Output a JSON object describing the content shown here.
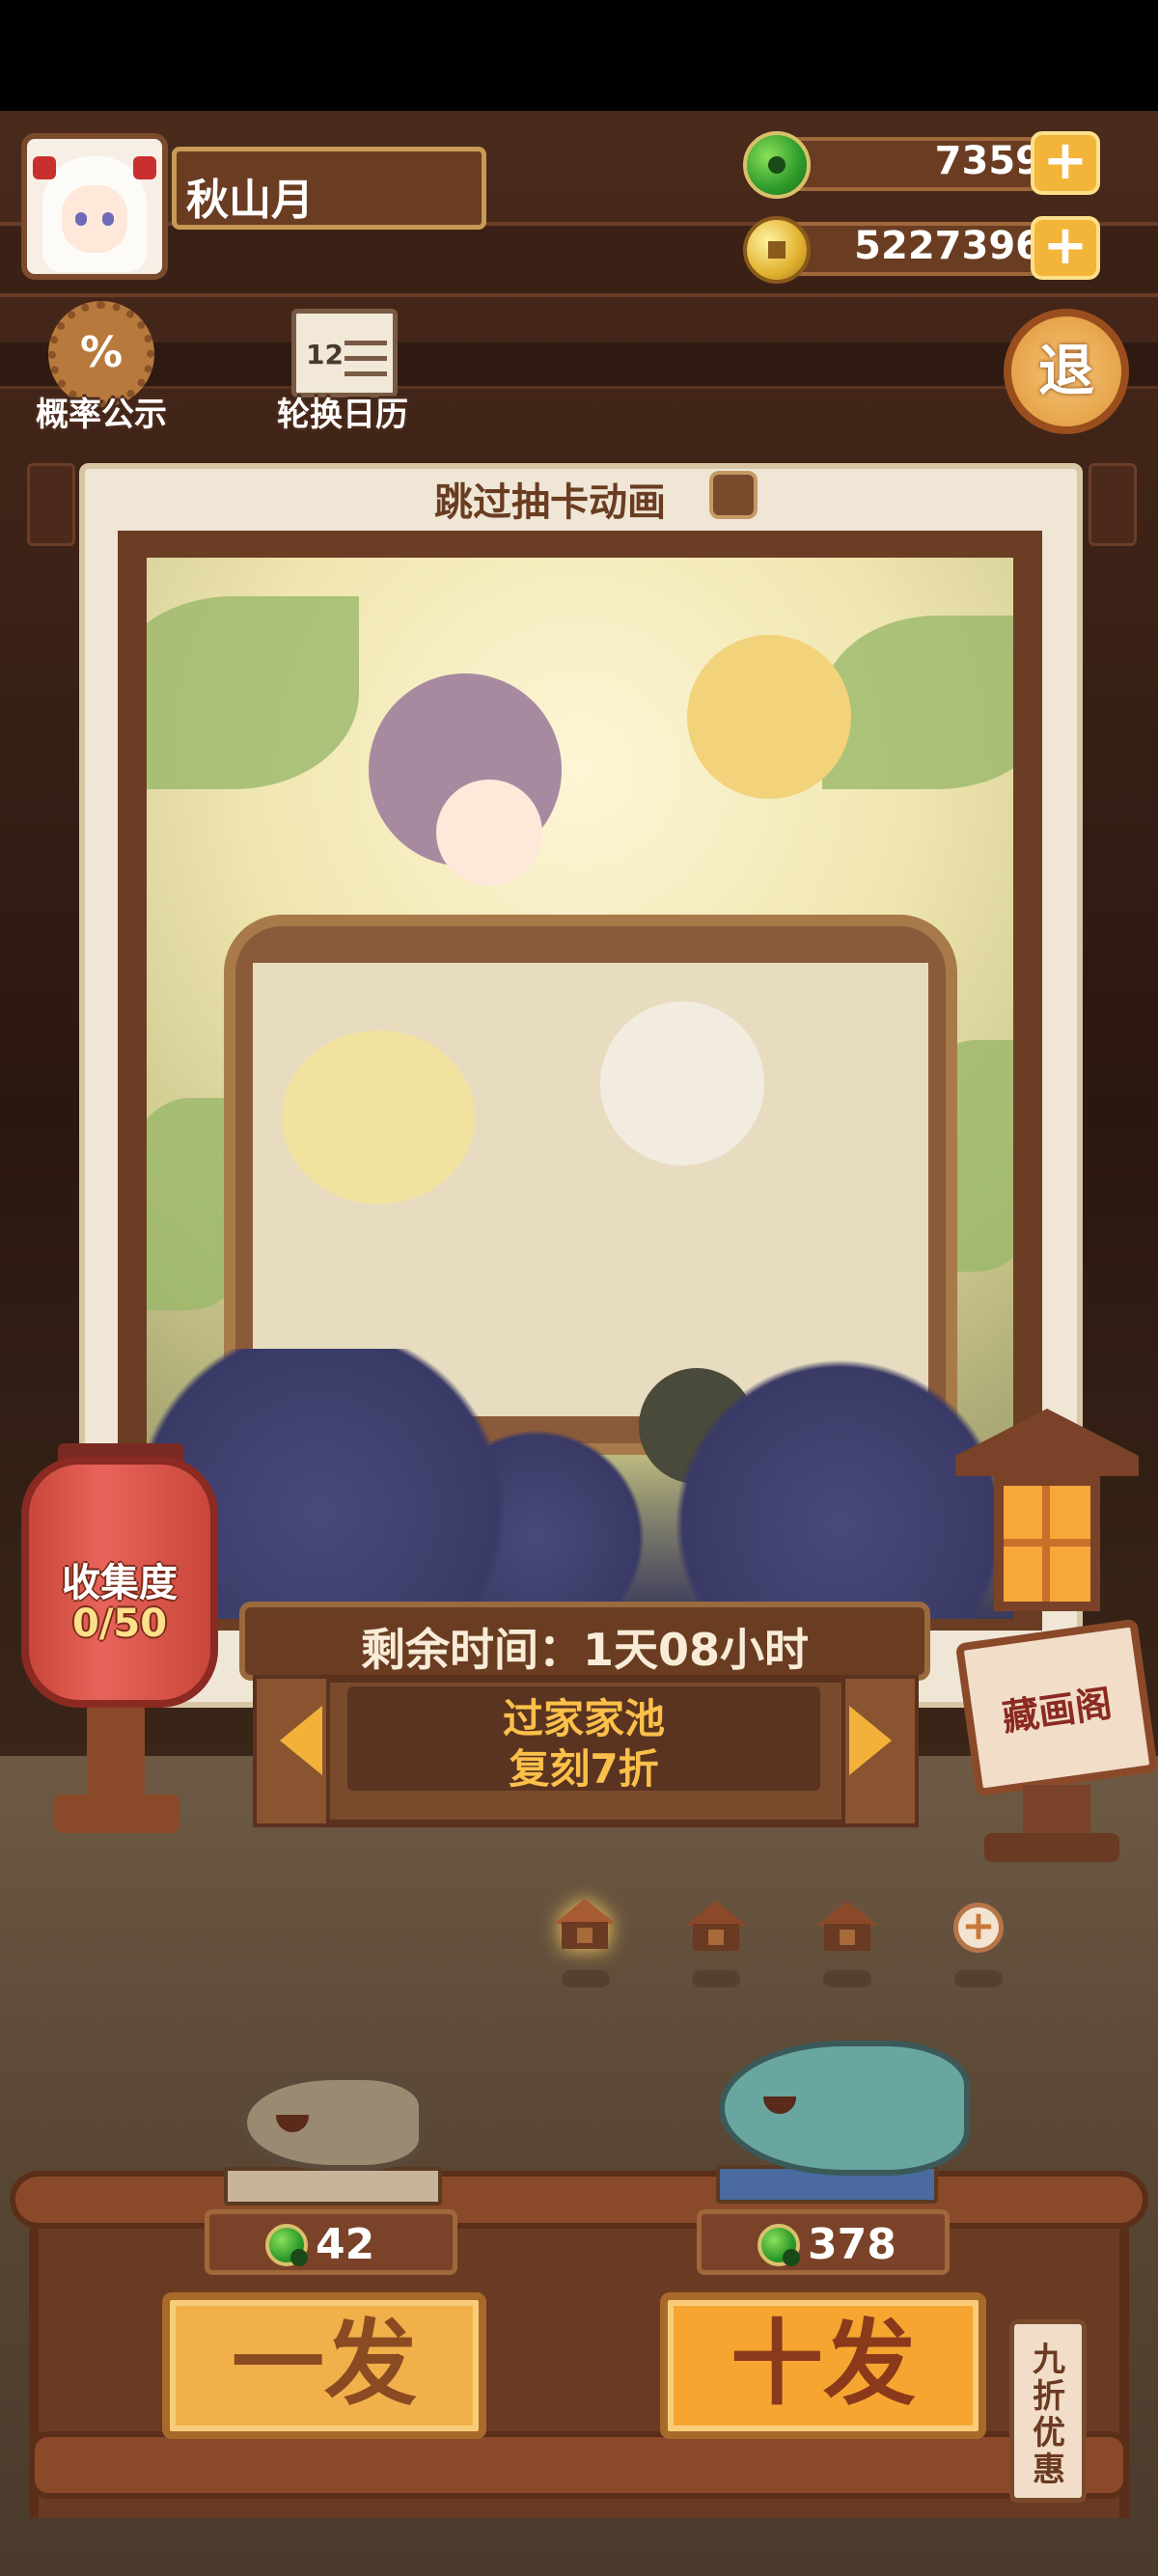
{
  "player": {
    "name": "秋山月"
  },
  "currency": {
    "jade": "7359",
    "gold": "5227396"
  },
  "top_icons": {
    "probability": "概率公示",
    "calendar": "轮换日历",
    "calendar_num": "12",
    "exit": "退"
  },
  "skip_animation": {
    "label": "跳过抽卡动画",
    "checked": false
  },
  "collection": {
    "title": "收集度",
    "value": "0/50"
  },
  "banner": {
    "remaining": "剩余时间：1天08小时",
    "pool_line1": "过家家池",
    "pool_line2": "复刻7折"
  },
  "gallery_sign": "藏画阁",
  "pages": {
    "count": 3,
    "active": 0
  },
  "draw": {
    "single": {
      "label": "一发",
      "cost": "42"
    },
    "ten": {
      "label": "十发",
      "cost": "378"
    },
    "discount_tag": "九折优惠"
  }
}
